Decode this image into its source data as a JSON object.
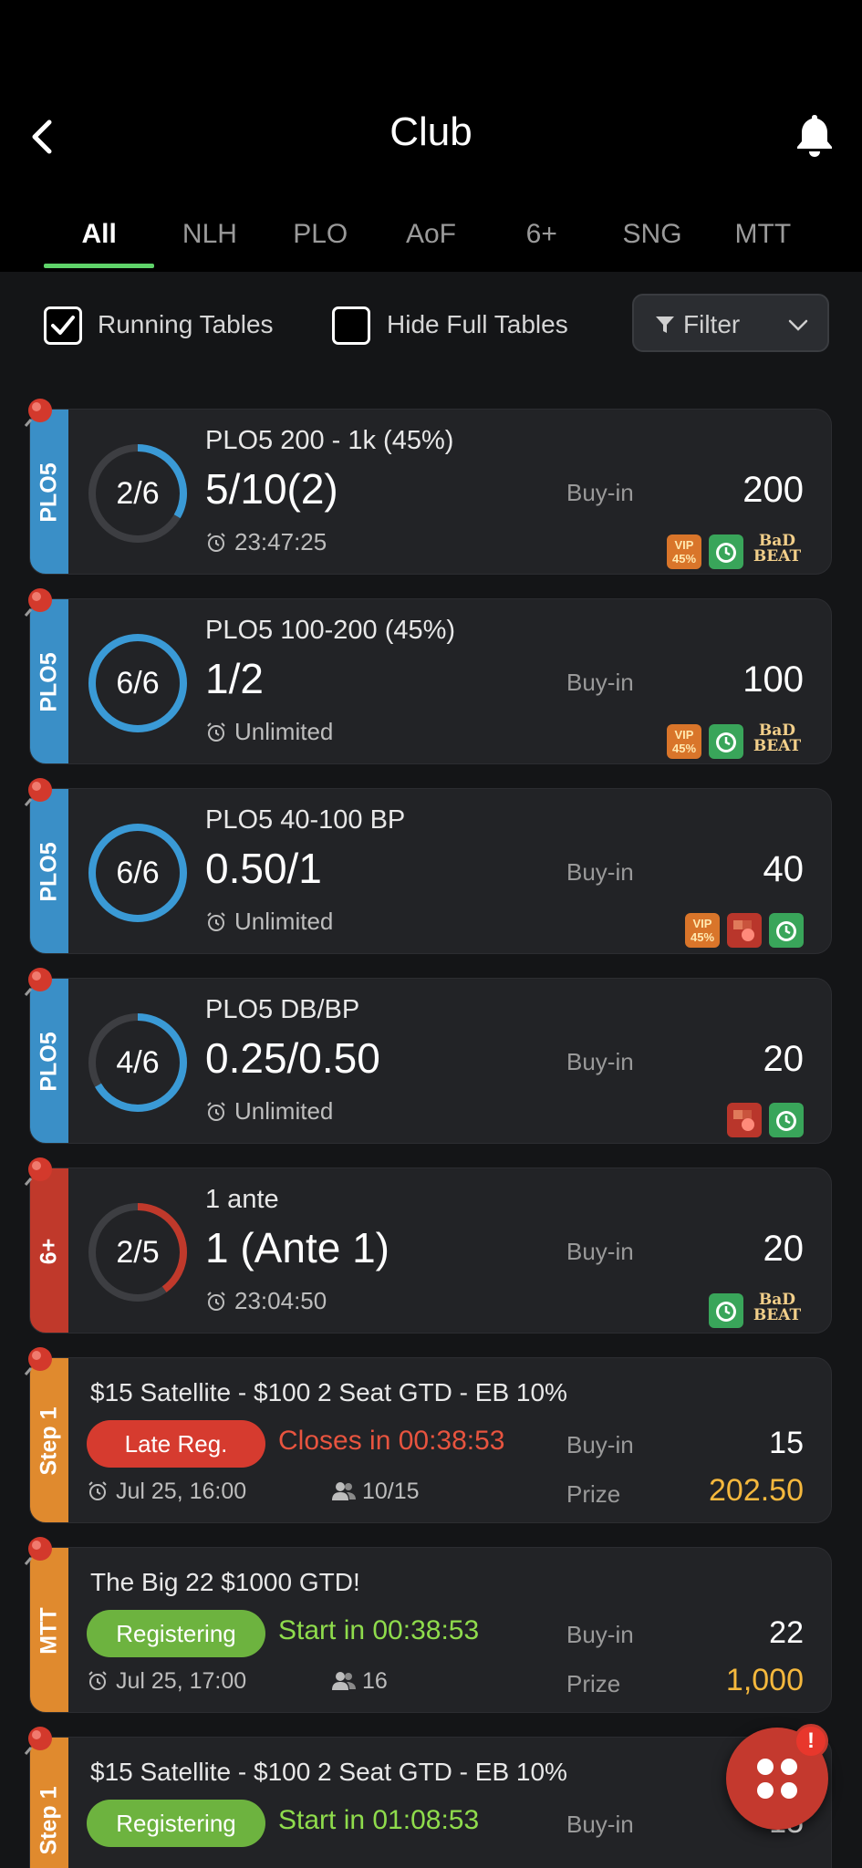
{
  "header": {
    "title": "Club"
  },
  "tabs": [
    {
      "label": "All",
      "active": true
    },
    {
      "label": "NLH"
    },
    {
      "label": "PLO"
    },
    {
      "label": "AoF"
    },
    {
      "label": "6+"
    },
    {
      "label": "SNG"
    },
    {
      "label": "MTT"
    }
  ],
  "filters": {
    "running_tables": {
      "label": "Running Tables",
      "checked": true
    },
    "hide_full_tables": {
      "label": "Hide Full Tables",
      "checked": false
    },
    "filter_button": "Filter"
  },
  "labels": {
    "buyin": "Buy-in",
    "prize": "Prize"
  },
  "tables": [
    {
      "tag": "PLO5",
      "seats": "2/6",
      "name": "PLO5 200 - 1k (45%)",
      "stakes": "5/10(2)",
      "timer": "23:47:25",
      "buyin": "200",
      "badges": [
        "vip",
        "clock",
        "badbeat"
      ]
    },
    {
      "tag": "PLO5",
      "seats": "6/6",
      "name": "PLO5 100-200 (45%)",
      "stakes": "1/2",
      "timer": "Unlimited",
      "buyin": "100",
      "badges": [
        "vip",
        "clock",
        "badbeat"
      ]
    },
    {
      "tag": "PLO5",
      "seats": "6/6",
      "name": "PLO5 40-100 BP",
      "stakes": "0.50/1",
      "timer": "Unlimited",
      "buyin": "40",
      "badges": [
        "vip",
        "bomb",
        "clock"
      ]
    },
    {
      "tag": "PLO5",
      "seats": "4/6",
      "name": "PLO5 DB/BP",
      "stakes": "0.25/0.50",
      "timer": "Unlimited",
      "buyin": "20",
      "badges": [
        "bomb",
        "clock"
      ]
    },
    {
      "tag": "6+",
      "seats": "2/5",
      "name": "1 ante",
      "stakes": "1 (Ante 1)",
      "timer": "23:04:50",
      "buyin": "20",
      "badges": [
        "clock",
        "badbeat"
      ]
    }
  ],
  "tournaments": [
    {
      "tag": "Step 1",
      "name": "$15 Satellite - $100 2 Seat GTD - EB 10%",
      "status": "Late Reg.",
      "status_text": "Closes in 00:38:53",
      "date": "Jul 25, 16:00",
      "players": "10/15",
      "buyin": "15",
      "prize": "202.50"
    },
    {
      "tag": "MTT",
      "name": "The Big 22 $1000 GTD!",
      "status": "Registering",
      "status_text": "Start in 00:38:53",
      "date": "Jul 25, 17:00",
      "players": "16",
      "buyin": "22",
      "prize": "1,000"
    },
    {
      "tag": "Step 1",
      "name": "$15 Satellite - $100 2 Seat GTD - EB 10%",
      "status": "Registering",
      "status_text": "Start in 01:08:53",
      "buyin": "15"
    }
  ],
  "badge_text": {
    "vip": "VIP\n45%",
    "badbeat": "BaD\nBEAT"
  },
  "fab": {
    "notification": "!"
  },
  "colors": {
    "accent_green": "#5fd36a",
    "plo5_strip": "#3a8fc7",
    "sixplus_strip": "#c0392b",
    "tournament_strip": "#e08a2e",
    "late_reg": "#d63b2f",
    "registering": "#6db33f",
    "prize": "#f5b83d"
  }
}
